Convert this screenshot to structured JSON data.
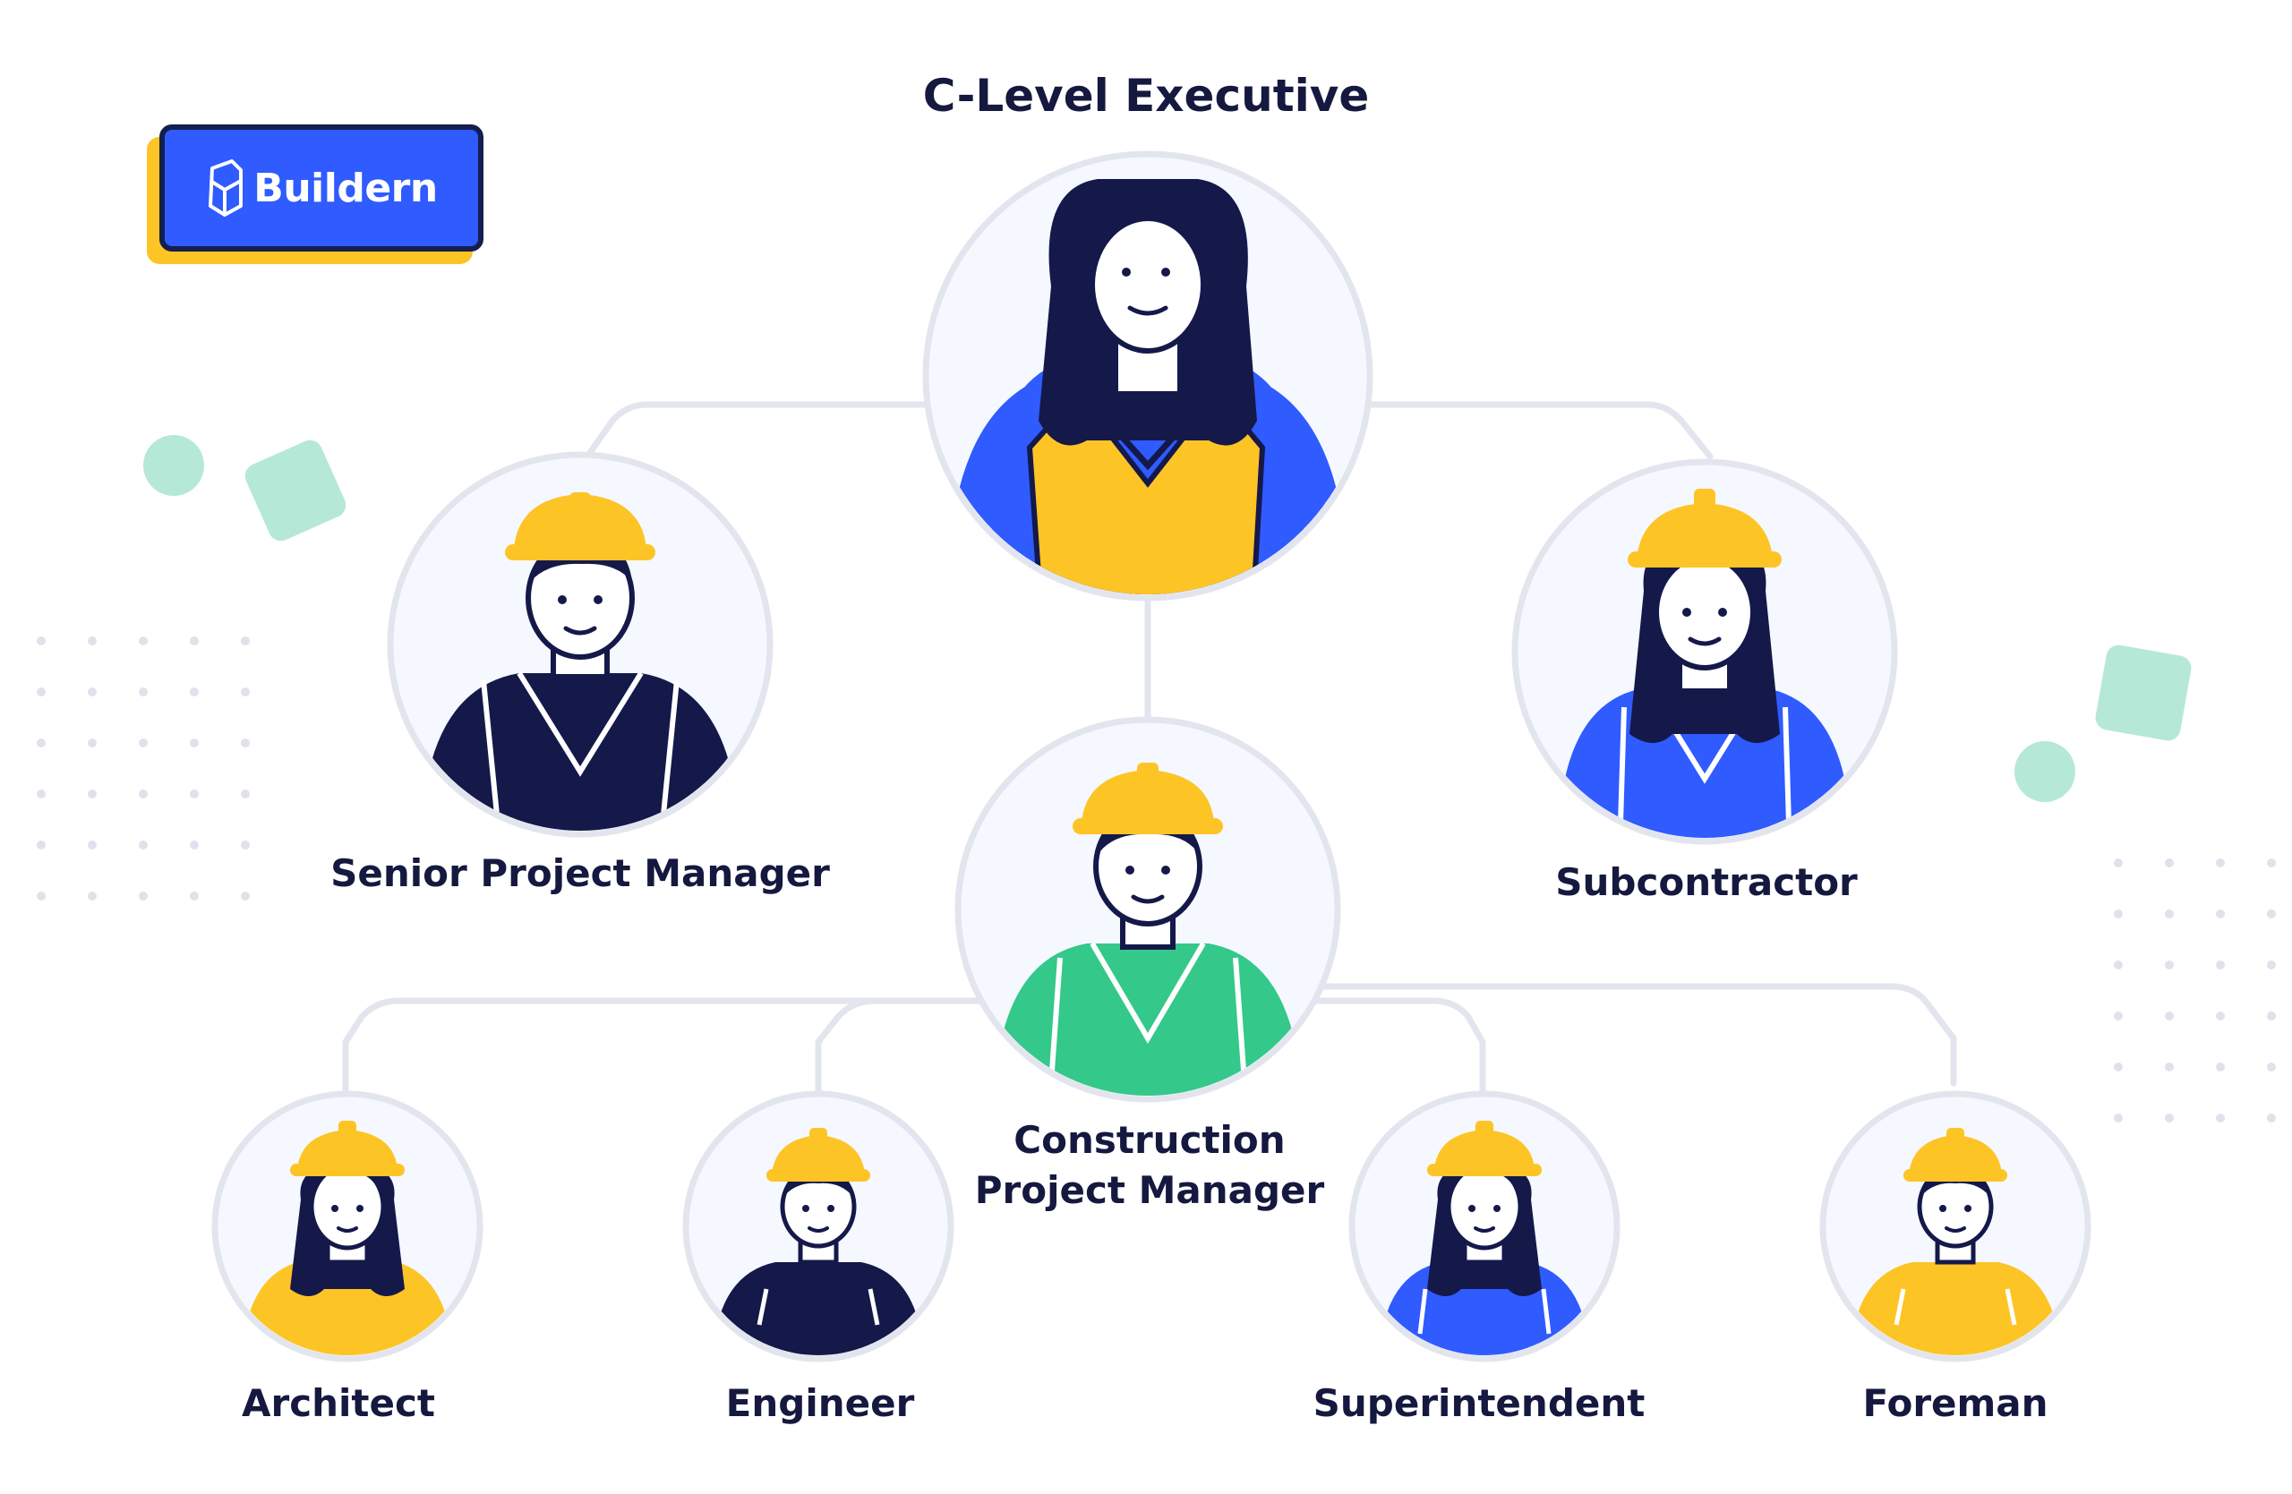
{
  "brand": {
    "name": "Buildern",
    "color": "#2f5bff",
    "accent": "#fdc425"
  },
  "title": "C-Level Executive",
  "roles": {
    "senior_pm": "Senior Project Manager",
    "subcontractor": "Subcontractor",
    "construction_pm_line1": "Construction",
    "construction_pm_line2": "Project Manager",
    "architect": "Architect",
    "engineer": "Engineer",
    "superintendent": "Superintendent",
    "foreman": "Foreman"
  },
  "colors": {
    "navy": "#14194a",
    "yellow": "#fdc425",
    "blue": "#2f5bff",
    "green": "#34c88a",
    "mint": "#b6e8d8",
    "line": "#e3e5ee"
  }
}
